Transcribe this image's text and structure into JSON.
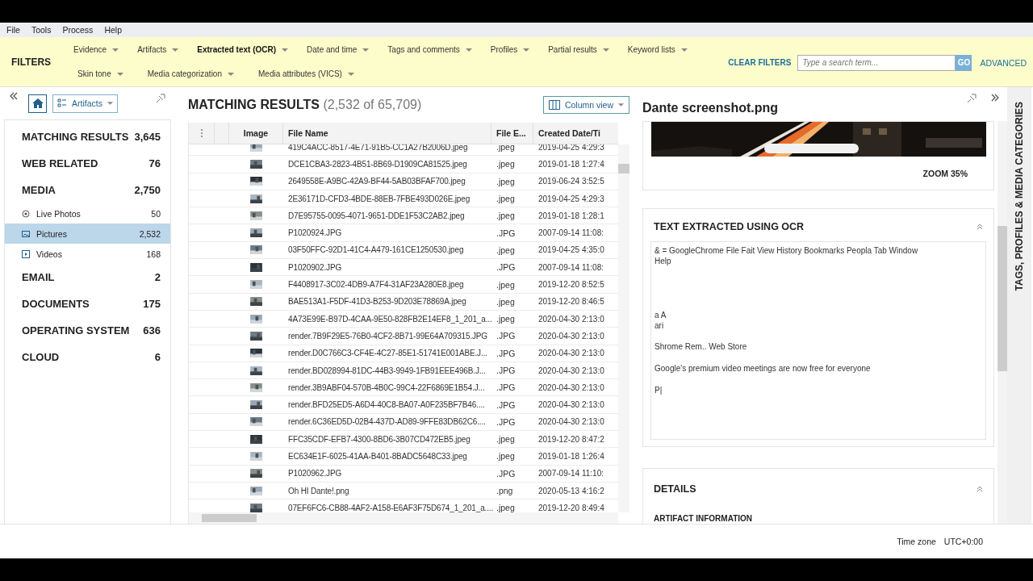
{
  "menu": [
    "File",
    "Tools",
    "Process",
    "Help"
  ],
  "filters": {
    "title": "FILTERS",
    "items": [
      {
        "label": "Evidence",
        "active": false
      },
      {
        "label": "Artifacts",
        "active": false
      },
      {
        "label": "Extracted text (OCR)",
        "active": true
      },
      {
        "label": "Date and time",
        "active": false
      },
      {
        "label": "Tags and comments",
        "active": false
      },
      {
        "label": "Profiles",
        "active": false
      },
      {
        "label": "Partial results",
        "active": false
      },
      {
        "label": "Keyword lists",
        "active": false
      },
      {
        "label": "Skin tone",
        "active": false
      },
      {
        "label": "Media categorization",
        "active": false
      },
      {
        "label": "Media attributes (VICS)",
        "active": false
      }
    ],
    "clear": "CLEAR FILTERS",
    "search": {
      "placeholder": "Type a search term..."
    },
    "go": "GO",
    "advanced": "ADVANCED"
  },
  "sidebar": {
    "view": "Artifacts",
    "items": [
      {
        "label": "MATCHING RESULTS",
        "count": "3,645"
      },
      {
        "label": "WEB RELATED",
        "count": "76"
      },
      {
        "label": "MEDIA",
        "count": "2,750",
        "children": [
          {
            "label": "Live Photos",
            "count": "50",
            "selected": false
          },
          {
            "label": "Pictures",
            "count": "2,532",
            "selected": true
          },
          {
            "label": "Videos",
            "count": "168",
            "selected": false
          }
        ]
      },
      {
        "label": "EMAIL",
        "count": "2"
      },
      {
        "label": "DOCUMENTS",
        "count": "175"
      },
      {
        "label": "OPERATING SYSTEM",
        "count": "636"
      },
      {
        "label": "CLOUD",
        "count": "6"
      }
    ]
  },
  "results": {
    "title": "MATCHING RESULTS",
    "count": "(2,532 of 65,709)",
    "view_button": "Column view",
    "columns": [
      "Image",
      "File Name",
      "File E...",
      "Created Date/Ti"
    ],
    "rows": [
      {
        "name": "419C4ACC-8517-4E71-91B5-CC1A27B2006D.jpeg",
        "ext": ".jpeg",
        "created": "2019-04-25 4:29:3"
      },
      {
        "name": "DCE1CBA3-2823-4B51-8B69-D1909CA81525.jpeg",
        "ext": ".jpeg",
        "created": "2019-01-18 1:27:4"
      },
      {
        "name": "2649558E-A9BC-42A9-BF44-5AB03BFAF700.jpeg",
        "ext": ".jpeg",
        "created": "2019-06-24 3:52:5"
      },
      {
        "name": "2E36171D-CFD3-4BDE-88EB-7FBE493D026E.jpeg",
        "ext": ".jpeg",
        "created": "2019-04-25 4:29:3"
      },
      {
        "name": "D7E95755-0095-4071-9651-DDE1F53C2AB2.jpeg",
        "ext": ".jpeg",
        "created": "2019-01-18 1:28:1"
      },
      {
        "name": "P1020924.JPG",
        "ext": ".JPG",
        "created": "2007-09-14 11:08:"
      },
      {
        "name": "03F50FFC-92D1-41C4-A479-161CE1250530.jpeg",
        "ext": ".jpeg",
        "created": "2019-04-25 4:35:0"
      },
      {
        "name": "P1020902.JPG",
        "ext": ".JPG",
        "created": "2007-09-14 11:08:"
      },
      {
        "name": "F4408917-3C02-4DB9-A7F4-31AF23A280E8.jpeg",
        "ext": ".jpeg",
        "created": "2019-12-20 8:52:5"
      },
      {
        "name": "BAE513A1-F5DF-41D3-B253-9D203E78869A.jpeg",
        "ext": ".jpeg",
        "created": "2019-12-20 8:46:5"
      },
      {
        "name": "4A73E99E-B97D-4CAA-9E50-828FB2E14EF8_1_201_a...",
        "ext": ".jpeg",
        "created": "2020-04-30 2:13:0"
      },
      {
        "name": "render.7B9F29E5-76B0-4CF2-8B71-99E64A709315.JPG",
        "ext": ".JPG",
        "created": "2020-04-30 2:13:0"
      },
      {
        "name": "render.D0C766C3-CF4E-4C27-85E1-51741E001ABE.J...",
        "ext": ".JPG",
        "created": "2020-04-30 2:13:0"
      },
      {
        "name": "render.BD028994-81DC-44B3-9949-1FB91EEE496B.J...",
        "ext": ".JPG",
        "created": "2020-04-30 2:13:0"
      },
      {
        "name": "render.3B9ABF04-570B-4B0C-99C4-22F6869E1B54.J...",
        "ext": ".JPG",
        "created": "2020-04-30 2:13:0"
      },
      {
        "name": "render.BFD25ED5-A6D4-40C8-BA07-A0F235BF7B46....",
        "ext": ".JPG",
        "created": "2020-04-30 2:13:0"
      },
      {
        "name": "render.6C36ED5D-02B4-437D-AD89-9FFE83DB62C6....",
        "ext": ".JPG",
        "created": "2020-04-30 2:13:0"
      },
      {
        "name": "FFC35CDF-EFB7-4300-8BD6-3B07CD472EB5.jpeg",
        "ext": ".jpeg",
        "created": "2019-12-20 8:47:2"
      },
      {
        "name": "EC634E1F-6025-41AA-B401-8BADC5648C33.jpeg",
        "ext": ".jpeg",
        "created": "2019-01-18 1:26:4"
      },
      {
        "name": "P1020962.JPG",
        "ext": ".JPG",
        "created": "2007-09-14 11:10:"
      },
      {
        "name": "Oh HI Dante!.png",
        "ext": ".png",
        "created": "2020-05-13 4:16:2"
      },
      {
        "name": "07EF6FC6-CB88-4AF2-A158-E6AF3F75D674_1_201_a....",
        "ext": ".jpeg",
        "created": "2019-12-20 8:49:4"
      }
    ]
  },
  "detail": {
    "title": "Dante screenshot.png",
    "zoom": "ZOOM 35%",
    "ocr": {
      "title": "TEXT EXTRACTED USING OCR",
      "blocks": [
        [
          "& = GoogleChrome File Fait View History Bookmarks Peopla Tab Window",
          "Help"
        ],
        [
          "a A",
          "ari"
        ],
        [
          "Shrome Rem.. Web Store"
        ],
        [
          "Google's premium video meetings are now free for everyone"
        ],
        [
          "P|"
        ]
      ]
    },
    "details": {
      "title": "DETAILS",
      "section": "ARTIFACT INFORMATION"
    }
  },
  "side_tab": "TAGS, PROFILES & MEDIA CATEGORIES",
  "status": {
    "label": "Time zone",
    "value": "UTC+0:00"
  }
}
